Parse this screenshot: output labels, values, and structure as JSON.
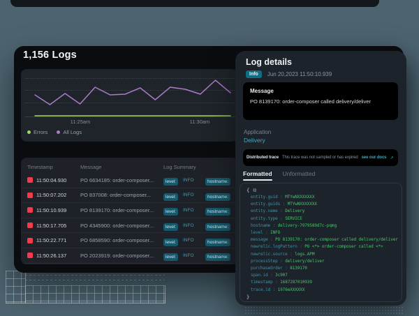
{
  "colors": {
    "background": "#4d6470",
    "accent_teal": "#3fa3b5",
    "error_red": "#f43b4d",
    "errors_series": "#9edb5a",
    "all_logs_series": "#a97bc9"
  },
  "logs_panel": {
    "title": "1,156 Logs",
    "table": {
      "columns": [
        "Timestamp",
        "Message",
        "Log Summary"
      ],
      "labels": {
        "level": "level:",
        "hostname": "hostname:"
      },
      "rows": [
        {
          "timestamp": "11:50:04.930",
          "message": "PO 6634185: order-composer...",
          "level": "INFO"
        },
        {
          "timestamp": "11:50:07.202",
          "message": "PO 837008: order-composer...",
          "level": "INFO"
        },
        {
          "timestamp": "11:50:10.939",
          "message": "PO 8139170: order-composer...",
          "level": "INFO"
        },
        {
          "timestamp": "11:50:17.705",
          "message": "PO 4345900: order-composer...",
          "level": "INFO"
        },
        {
          "timestamp": "11:50:22.771",
          "message": "PO 6858590: order-composer...",
          "level": "INFO"
        },
        {
          "timestamp": "11:50:26.137",
          "message": "PO 2023919: order-composer...",
          "level": "INFO"
        }
      ]
    }
  },
  "chart_data": {
    "type": "line",
    "title": "1,156 Logs",
    "x_ticks": [
      "11:25am",
      "11:30am"
    ],
    "ylim": [
      0,
      60
    ],
    "grid": "horizontal-dotted",
    "legend_position": "bottom-left",
    "series": [
      {
        "name": "Errors",
        "color": "#9edb5a",
        "values": [
          1,
          1,
          1,
          1,
          1,
          1,
          1,
          1,
          1,
          1,
          1,
          1,
          1,
          1
        ]
      },
      {
        "name": "All Logs",
        "color": "#a97bc9",
        "values": [
          31,
          17,
          33,
          18,
          42,
          31,
          32,
          41,
          24,
          42,
          39,
          32,
          52,
          34
        ]
      }
    ]
  },
  "details_panel": {
    "title": "Log details",
    "severity_badge": "Info",
    "timestamp": "Jun 20,2023 11:50:10.939",
    "message": {
      "label": "Message",
      "text": "PO 8139170: order-composer called delivery/deliver"
    },
    "application": {
      "label": "Application",
      "value": "Delivery"
    },
    "trace": {
      "label": "Distributed trace",
      "status": "This trace was not sampled or has expired",
      "link": "see our docs"
    },
    "tabs": [
      {
        "label": "Formatted"
      },
      {
        "label": "Unformatted"
      }
    ],
    "icons": {
      "external_link": "↗",
      "copy": "⧉"
    },
    "code": {
      "open_brace": "{",
      "close_brace": "}",
      "separator": " : ",
      "fields": [
        {
          "key": "entity.guid",
          "value": "MTYwNXXXXXXX"
        },
        {
          "key": "entity.guids",
          "value": "MTYwNXXXXXXX"
        },
        {
          "key": "entity.name",
          "value": "Delivery"
        },
        {
          "key": "entity.type",
          "value": "SERVICE"
        },
        {
          "key": "hostname",
          "value": "delivery-7979589d7c-pqmg"
        },
        {
          "key": "level",
          "value": "INFO"
        },
        {
          "key": "message",
          "value": "PO 8139170: order-composer called delivery/deliver"
        },
        {
          "key": "newrelic.logPattern",
          "value": "PO <*> order-composer called <*>"
        },
        {
          "key": "newrelic.source",
          "value": "logs.APM"
        },
        {
          "key": "processStep",
          "value": "delivery/deliver"
        },
        {
          "key": "purchaseOrder",
          "value": "8139170"
        },
        {
          "key": "span.id",
          "value": "3c907"
        },
        {
          "key": "timestamp",
          "value": "1687287010939"
        },
        {
          "key": "trace.id",
          "value": "1976eXXXXXX"
        }
      ]
    }
  }
}
